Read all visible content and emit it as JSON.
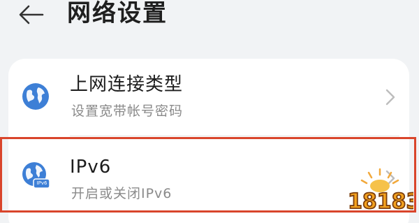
{
  "header": {
    "title": "网络设置",
    "back_icon": "arrow-left-icon"
  },
  "settings": [
    {
      "title": "上网连接类型",
      "subtitle": "设置宽带帐号密码",
      "icon": "globe-icon"
    },
    {
      "title": "IPv6",
      "subtitle": "开启或关闭IPv6",
      "icon": "globe-ipv6-icon",
      "icon_badge": "IPv6",
      "highlighted": true
    }
  ],
  "watermark": {
    "text": "18183"
  },
  "colors": {
    "background": "#f1f3f5",
    "card": "#ffffff",
    "icon_blue": "#3d7fd6",
    "highlight_border": "#d9452b",
    "title_text": "#1c1c1c",
    "subtitle_text": "#8a8a8a"
  }
}
